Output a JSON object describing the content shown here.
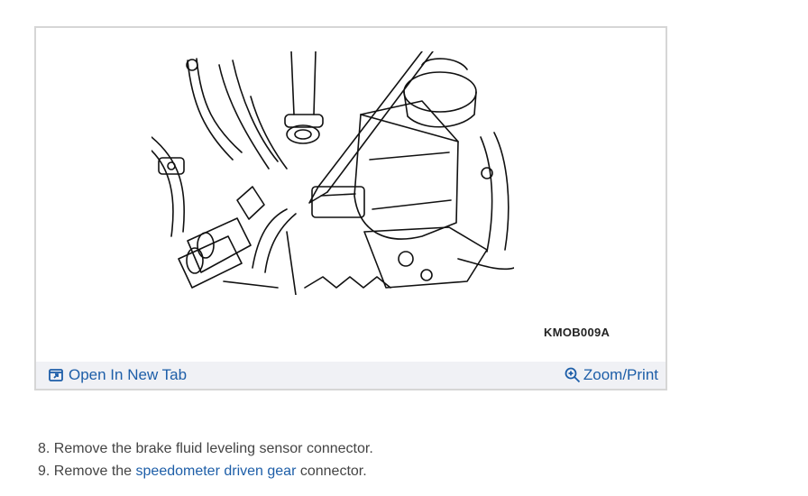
{
  "figure": {
    "code": "KMOB009A",
    "open_tab_label": "Open In New Tab",
    "zoom_print_label": "Zoom/Print",
    "accent_color": "#1d5ea8",
    "bar_color": "#f0f1f5"
  },
  "steps": [
    {
      "number": "8.",
      "text": "Remove the brake fluid leveling sensor connector."
    },
    {
      "number": "9.",
      "text_before": "Remove the",
      "link": "speedometer driven gear",
      "text_after": "connector."
    }
  ]
}
